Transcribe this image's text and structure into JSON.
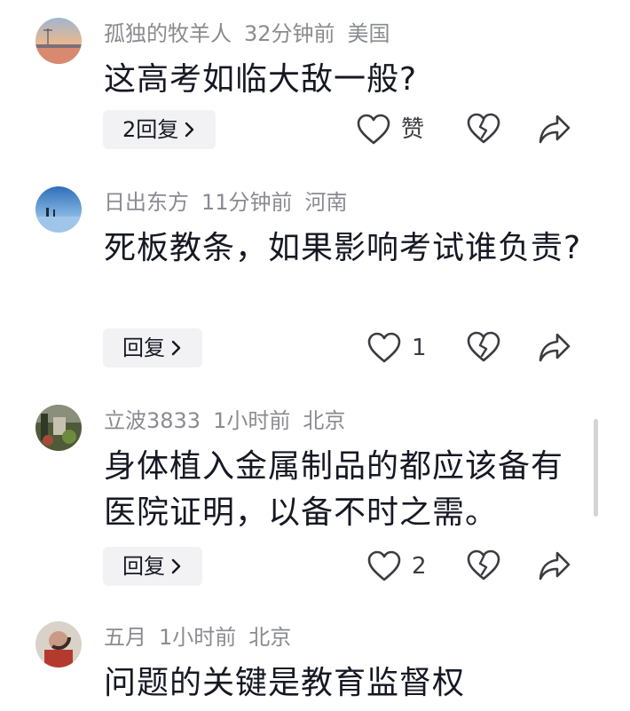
{
  "comments": [
    {
      "username": "孤独的牧羊人",
      "time": "32分钟前",
      "location": "美国",
      "text": "这高考如临大敌一般?",
      "reply_label": "2回复",
      "like_label": "赞",
      "avatar": "sunset-lake-avatar"
    },
    {
      "username": "日出东方",
      "time": "11分钟前",
      "location": "河南",
      "text": "死板教条，如果影响考试谁负责?",
      "reply_label": "回复",
      "like_label": "1",
      "avatar": "blue-sky-avatar"
    },
    {
      "username": "立波3833",
      "time": "1小时前",
      "location": "北京",
      "text": "身体植入金属制品的都应该备有医院证明，以备不时之需。",
      "reply_label": "回复",
      "like_label": "2",
      "avatar": "garden-avatar"
    },
    {
      "username": "五月",
      "time": "1小时前",
      "location": "北京",
      "text": "问题的关键是教育监督权",
      "avatar": "portrait-avatar"
    }
  ],
  "icons": {
    "like": "heart-outline-icon",
    "dislike": "broken-heart-icon",
    "share": "share-arrow-icon",
    "reply_chevron": "chevron-right-icon"
  },
  "colors": {
    "meta": "#8a8b91",
    "text": "#161823",
    "reply_bg": "#f2f2f4",
    "icon": "#3b3c42"
  }
}
